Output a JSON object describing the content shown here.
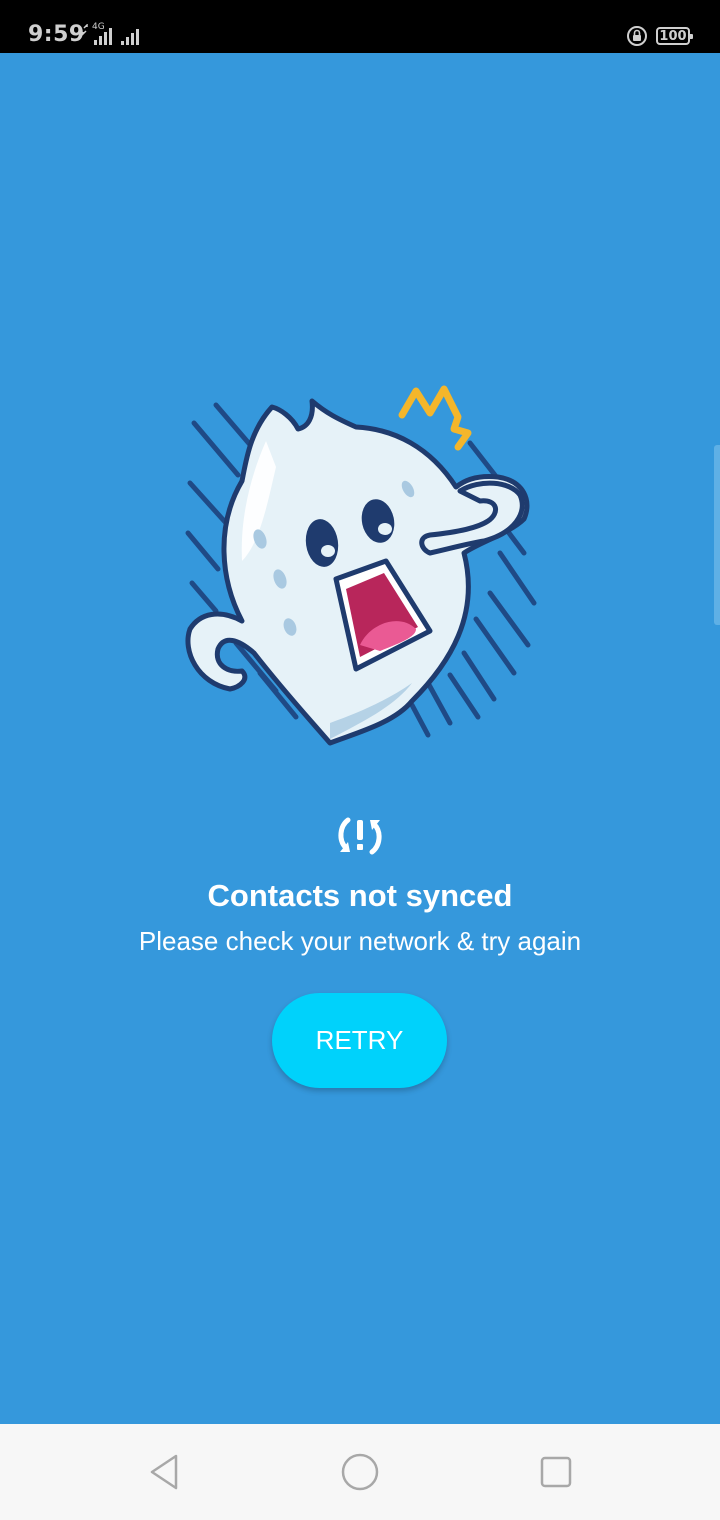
{
  "status_bar": {
    "time": "9:59",
    "network_label": "4G",
    "battery": "100",
    "icons": [
      "signal-icon",
      "screen-lock-icon",
      "battery-icon"
    ]
  },
  "illustration": {
    "icon": "scared-ghost-illustration"
  },
  "sync_error": {
    "icon": "sync-error-icon",
    "title": "Contacts not synced",
    "message": "Please check your network & try again",
    "button_label": "RETRY"
  },
  "nav_bar": {
    "icons": [
      "back-icon",
      "home-icon",
      "recents-icon"
    ]
  },
  "colors": {
    "background": "#3598dc",
    "button": "#00d2fb",
    "status_bar": "#000000",
    "nav_bar": "#f7f7f7",
    "text": "#ffffff"
  }
}
